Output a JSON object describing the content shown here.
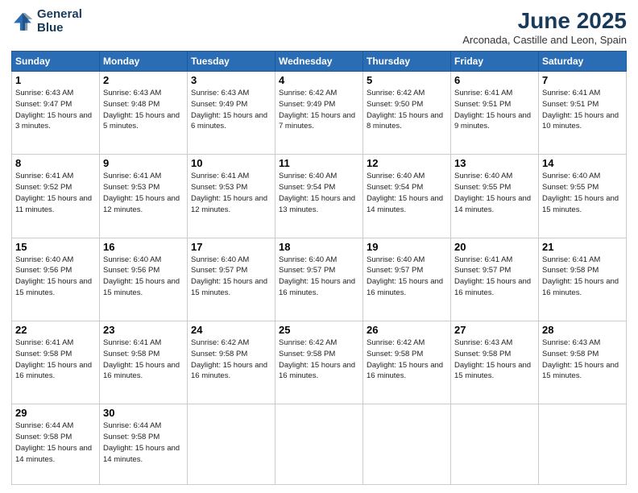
{
  "header": {
    "logo_line1": "General",
    "logo_line2": "Blue",
    "main_title": "June 2025",
    "subtitle": "Arconada, Castille and Leon, Spain"
  },
  "calendar": {
    "headers": [
      "Sunday",
      "Monday",
      "Tuesday",
      "Wednesday",
      "Thursday",
      "Friday",
      "Saturday"
    ],
    "rows": [
      [
        {
          "day": "1",
          "sunrise": "Sunrise: 6:43 AM",
          "sunset": "Sunset: 9:47 PM",
          "daylight": "Daylight: 15 hours and 3 minutes."
        },
        {
          "day": "2",
          "sunrise": "Sunrise: 6:43 AM",
          "sunset": "Sunset: 9:48 PM",
          "daylight": "Daylight: 15 hours and 5 minutes."
        },
        {
          "day": "3",
          "sunrise": "Sunrise: 6:43 AM",
          "sunset": "Sunset: 9:49 PM",
          "daylight": "Daylight: 15 hours and 6 minutes."
        },
        {
          "day": "4",
          "sunrise": "Sunrise: 6:42 AM",
          "sunset": "Sunset: 9:49 PM",
          "daylight": "Daylight: 15 hours and 7 minutes."
        },
        {
          "day": "5",
          "sunrise": "Sunrise: 6:42 AM",
          "sunset": "Sunset: 9:50 PM",
          "daylight": "Daylight: 15 hours and 8 minutes."
        },
        {
          "day": "6",
          "sunrise": "Sunrise: 6:41 AM",
          "sunset": "Sunset: 9:51 PM",
          "daylight": "Daylight: 15 hours and 9 minutes."
        },
        {
          "day": "7",
          "sunrise": "Sunrise: 6:41 AM",
          "sunset": "Sunset: 9:51 PM",
          "daylight": "Daylight: 15 hours and 10 minutes."
        }
      ],
      [
        {
          "day": "8",
          "sunrise": "Sunrise: 6:41 AM",
          "sunset": "Sunset: 9:52 PM",
          "daylight": "Daylight: 15 hours and 11 minutes."
        },
        {
          "day": "9",
          "sunrise": "Sunrise: 6:41 AM",
          "sunset": "Sunset: 9:53 PM",
          "daylight": "Daylight: 15 hours and 12 minutes."
        },
        {
          "day": "10",
          "sunrise": "Sunrise: 6:41 AM",
          "sunset": "Sunset: 9:53 PM",
          "daylight": "Daylight: 15 hours and 12 minutes."
        },
        {
          "day": "11",
          "sunrise": "Sunrise: 6:40 AM",
          "sunset": "Sunset: 9:54 PM",
          "daylight": "Daylight: 15 hours and 13 minutes."
        },
        {
          "day": "12",
          "sunrise": "Sunrise: 6:40 AM",
          "sunset": "Sunset: 9:54 PM",
          "daylight": "Daylight: 15 hours and 14 minutes."
        },
        {
          "day": "13",
          "sunrise": "Sunrise: 6:40 AM",
          "sunset": "Sunset: 9:55 PM",
          "daylight": "Daylight: 15 hours and 14 minutes."
        },
        {
          "day": "14",
          "sunrise": "Sunrise: 6:40 AM",
          "sunset": "Sunset: 9:55 PM",
          "daylight": "Daylight: 15 hours and 15 minutes."
        }
      ],
      [
        {
          "day": "15",
          "sunrise": "Sunrise: 6:40 AM",
          "sunset": "Sunset: 9:56 PM",
          "daylight": "Daylight: 15 hours and 15 minutes."
        },
        {
          "day": "16",
          "sunrise": "Sunrise: 6:40 AM",
          "sunset": "Sunset: 9:56 PM",
          "daylight": "Daylight: 15 hours and 15 minutes."
        },
        {
          "day": "17",
          "sunrise": "Sunrise: 6:40 AM",
          "sunset": "Sunset: 9:57 PM",
          "daylight": "Daylight: 15 hours and 15 minutes."
        },
        {
          "day": "18",
          "sunrise": "Sunrise: 6:40 AM",
          "sunset": "Sunset: 9:57 PM",
          "daylight": "Daylight: 15 hours and 16 minutes."
        },
        {
          "day": "19",
          "sunrise": "Sunrise: 6:40 AM",
          "sunset": "Sunset: 9:57 PM",
          "daylight": "Daylight: 15 hours and 16 minutes."
        },
        {
          "day": "20",
          "sunrise": "Sunrise: 6:41 AM",
          "sunset": "Sunset: 9:57 PM",
          "daylight": "Daylight: 15 hours and 16 minutes."
        },
        {
          "day": "21",
          "sunrise": "Sunrise: 6:41 AM",
          "sunset": "Sunset: 9:58 PM",
          "daylight": "Daylight: 15 hours and 16 minutes."
        }
      ],
      [
        {
          "day": "22",
          "sunrise": "Sunrise: 6:41 AM",
          "sunset": "Sunset: 9:58 PM",
          "daylight": "Daylight: 15 hours and 16 minutes."
        },
        {
          "day": "23",
          "sunrise": "Sunrise: 6:41 AM",
          "sunset": "Sunset: 9:58 PM",
          "daylight": "Daylight: 15 hours and 16 minutes."
        },
        {
          "day": "24",
          "sunrise": "Sunrise: 6:42 AM",
          "sunset": "Sunset: 9:58 PM",
          "daylight": "Daylight: 15 hours and 16 minutes."
        },
        {
          "day": "25",
          "sunrise": "Sunrise: 6:42 AM",
          "sunset": "Sunset: 9:58 PM",
          "daylight": "Daylight: 15 hours and 16 minutes."
        },
        {
          "day": "26",
          "sunrise": "Sunrise: 6:42 AM",
          "sunset": "Sunset: 9:58 PM",
          "daylight": "Daylight: 15 hours and 16 minutes."
        },
        {
          "day": "27",
          "sunrise": "Sunrise: 6:43 AM",
          "sunset": "Sunset: 9:58 PM",
          "daylight": "Daylight: 15 hours and 15 minutes."
        },
        {
          "day": "28",
          "sunrise": "Sunrise: 6:43 AM",
          "sunset": "Sunset: 9:58 PM",
          "daylight": "Daylight: 15 hours and 15 minutes."
        }
      ],
      [
        {
          "day": "29",
          "sunrise": "Sunrise: 6:44 AM",
          "sunset": "Sunset: 9:58 PM",
          "daylight": "Daylight: 15 hours and 14 minutes."
        },
        {
          "day": "30",
          "sunrise": "Sunrise: 6:44 AM",
          "sunset": "Sunset: 9:58 PM",
          "daylight": "Daylight: 15 hours and 14 minutes."
        },
        {
          "day": "",
          "sunrise": "",
          "sunset": "",
          "daylight": ""
        },
        {
          "day": "",
          "sunrise": "",
          "sunset": "",
          "daylight": ""
        },
        {
          "day": "",
          "sunrise": "",
          "sunset": "",
          "daylight": ""
        },
        {
          "day": "",
          "sunrise": "",
          "sunset": "",
          "daylight": ""
        },
        {
          "day": "",
          "sunrise": "",
          "sunset": "",
          "daylight": ""
        }
      ]
    ]
  }
}
